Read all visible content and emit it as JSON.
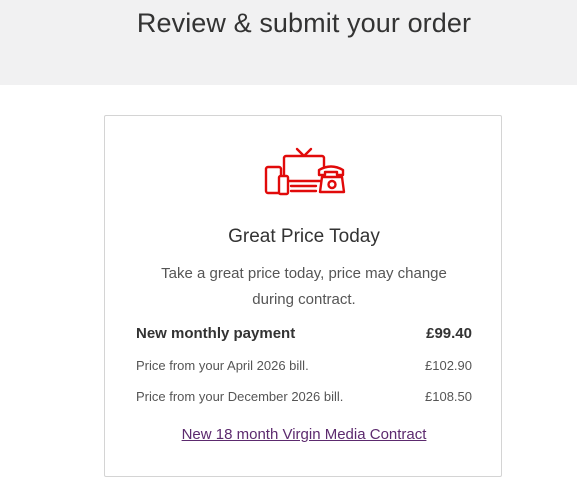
{
  "header": {
    "title": "Review & submit your order"
  },
  "card": {
    "icon": "tv-phone-tablet-devices-icon",
    "title": "Great Price Today",
    "description": "Take a great price today, price may change during contract.",
    "monthly": {
      "label": "New monthly payment",
      "value": "£99.40"
    },
    "price_changes": [
      {
        "label": "Price from your April 2026 bill.",
        "value": "£102.90"
      },
      {
        "label": "Price from your December 2026 bill.",
        "value": "£108.50"
      }
    ],
    "contract_link": "New 18 month Virgin Media Contract"
  },
  "colors": {
    "brand_red": "#e10a0a",
    "link_purple": "#5c2a6e",
    "header_bg": "#f1f1f2"
  }
}
